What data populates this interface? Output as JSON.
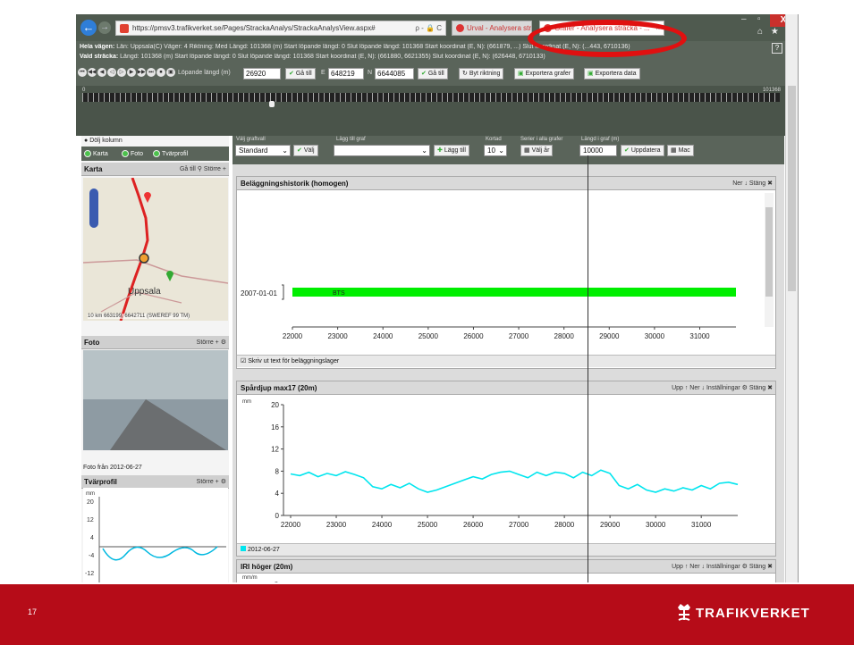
{
  "browser": {
    "address": "https://pmsv3.trafikverket.se/Pages/StrackaAnalys/StrackaAnalysView.aspx#",
    "address_tools": "ρ - 🔒 C",
    "tabs": [
      {
        "label": "Urval - Analysera sträcka ..."
      },
      {
        "label": "Grafer - Analysera sträcka - ...",
        "close": "×"
      }
    ],
    "window_controls": {
      "minimize": "–",
      "maximize": "▫",
      "close": "X"
    },
    "fav_tools": "⌂ ★ ✿"
  },
  "info": {
    "row1": {
      "label": "Hela vägen:",
      "text": "Län: Uppsala(C) Väger: 4 Riktning: Med Längd: 101368 (m) Start löpande längd: 0 Slut löpande längd: 101368 Start koordinat (E, N): (661879, ...) Slut koordinat (E, N): (...443, 6710136)"
    },
    "row2": {
      "label": "Vald sträcka:",
      "text": "Längd: 101368 (m) Start löpande längd: 0 Slut löpande längd: 101368 Start koordinat (E, N): (661880, 6621355) Slut koordinat (E, N): (626448, 6710133)"
    },
    "help": "?",
    "nav_symbols": [
      "⏮",
      "◀◀",
      "◀",
      "◁",
      "▷",
      "▶",
      "▶▶",
      "⏭",
      "⏹",
      "▣"
    ],
    "lopande_label": "Löpande längd (m)",
    "lopande_value": "26920",
    "goto_label": "Gå till",
    "e_label": "E",
    "e_value": "648219",
    "n_label": "N",
    "n_value": "6644085",
    "byt_riktning": "Byt riktning",
    "export_graphs": "Exportera grafer",
    "export_data": "Exportera data"
  },
  "timeline": {
    "start": "0",
    "end": "101368"
  },
  "left": {
    "hide_column": "Dölj kolumn",
    "toggles": [
      "Karta",
      "Foto",
      "Tvärprofil"
    ],
    "map": {
      "title": "Karta",
      "goto": "Gå till",
      "bigger": "Större +",
      "city": "Uppsala",
      "scale": "10 km  663199, 6642711 (SWEREF 99 TM)"
    },
    "photo": {
      "title": "Foto",
      "bigger": "Större +",
      "caption": "Foto från 2012-06-27"
    },
    "xprofile": {
      "title": "Tvärprofil",
      "bigger": "Större +",
      "unit": "mm",
      "yticks": [
        "20",
        "12",
        "4",
        "-4",
        "-12"
      ]
    }
  },
  "controls": {
    "choose_graph_label": "Välj graftvall",
    "choose_graph_value": "Standard",
    "choose_btn": "Välj",
    "add_graph_label": "Lägg till graf",
    "add_btn": "Lägg till",
    "interval_label": "Kortad",
    "interval_value": "10",
    "series_label": "Serier i alla grafer",
    "series_btn": "Välj år",
    "length_label": "Längd i graf (m)",
    "length_value": "10000",
    "update_btn": "Uppdatera",
    "mac_btn": "Mac"
  },
  "graphs": [
    {
      "title": "Beläggningshistorik (homogen)",
      "actions": "Ner ↓   Stäng ✖",
      "footer": "Skriv ut text för beläggningslager"
    },
    {
      "title": "Spårdjup max17 (20m)",
      "actions": "Upp ↑   Ner ↓   Inställningar ⚙   Stäng ✖",
      "footer": "2012-06-27"
    },
    {
      "title": "IRI höger (20m)",
      "actions": "Upp ↑   Ner ↓   Inställningar ⚙   Stäng ✖",
      "unit": "mm/m",
      "ytick": "8"
    }
  ],
  "chart_data": [
    {
      "type": "bar",
      "title": "Beläggningshistorik (homogen)",
      "xlim": [
        22000,
        31800
      ],
      "xticks": [
        "22000",
        "23000",
        "24000",
        "25000",
        "26000",
        "27000",
        "28000",
        "29000",
        "30000",
        "31000"
      ],
      "categories": [
        "2007-01-01"
      ],
      "bars": [
        {
          "category": "2007-01-01",
          "x_start": 22000,
          "x_end": 31800,
          "label": "BTS",
          "color": "#00ee00"
        }
      ]
    },
    {
      "type": "line",
      "title": "Spårdjup max17 (20m)",
      "ylabel": "mm",
      "ylim": [
        0,
        20
      ],
      "yticks": [
        "0",
        "4",
        "8",
        "12",
        "16",
        "20"
      ],
      "xlim": [
        22000,
        31800
      ],
      "xticks": [
        "22000",
        "23000",
        "24000",
        "25000",
        "26000",
        "27000",
        "28000",
        "29000",
        "30000",
        "31000"
      ],
      "series": [
        {
          "name": "2012-06-27",
          "color": "#00e5ee",
          "x": [
            22000,
            22200,
            22400,
            22600,
            22800,
            23000,
            23200,
            23400,
            23600,
            23800,
            24000,
            24200,
            24400,
            24600,
            24800,
            25000,
            25200,
            25400,
            25600,
            25800,
            26000,
            26200,
            26400,
            26600,
            26800,
            27000,
            27200,
            27400,
            27600,
            27800,
            28000,
            28200,
            28400,
            28600,
            28800,
            29000,
            29200,
            29400,
            29600,
            29800,
            30000,
            30200,
            30400,
            30600,
            30800,
            31000,
            31200,
            31400,
            31600,
            31800
          ],
          "y": [
            7.5,
            7.2,
            7.8,
            7.0,
            7.6,
            7.2,
            7.9,
            7.4,
            6.8,
            5.2,
            4.8,
            5.6,
            5.0,
            5.8,
            4.8,
            4.2,
            4.6,
            5.2,
            5.8,
            6.4,
            7.0,
            6.6,
            7.4,
            7.8,
            8.0,
            7.4,
            6.8,
            7.8,
            7.2,
            7.8,
            7.6,
            6.8,
            7.8,
            7.2,
            8.2,
            7.6,
            5.4,
            4.8,
            5.6,
            4.6,
            4.2,
            4.8,
            4.4,
            5.0,
            4.6,
            5.4,
            4.8,
            5.8,
            6.0,
            5.6
          ]
        }
      ]
    }
  ],
  "slide": {
    "page": "17",
    "brand": "TRAFIKVERKET"
  },
  "colors": {
    "footer": "#b60c18",
    "highlight_ellipse": "#e01010",
    "bts_bar": "#00ee00",
    "rut_line": "#00e5ee"
  }
}
